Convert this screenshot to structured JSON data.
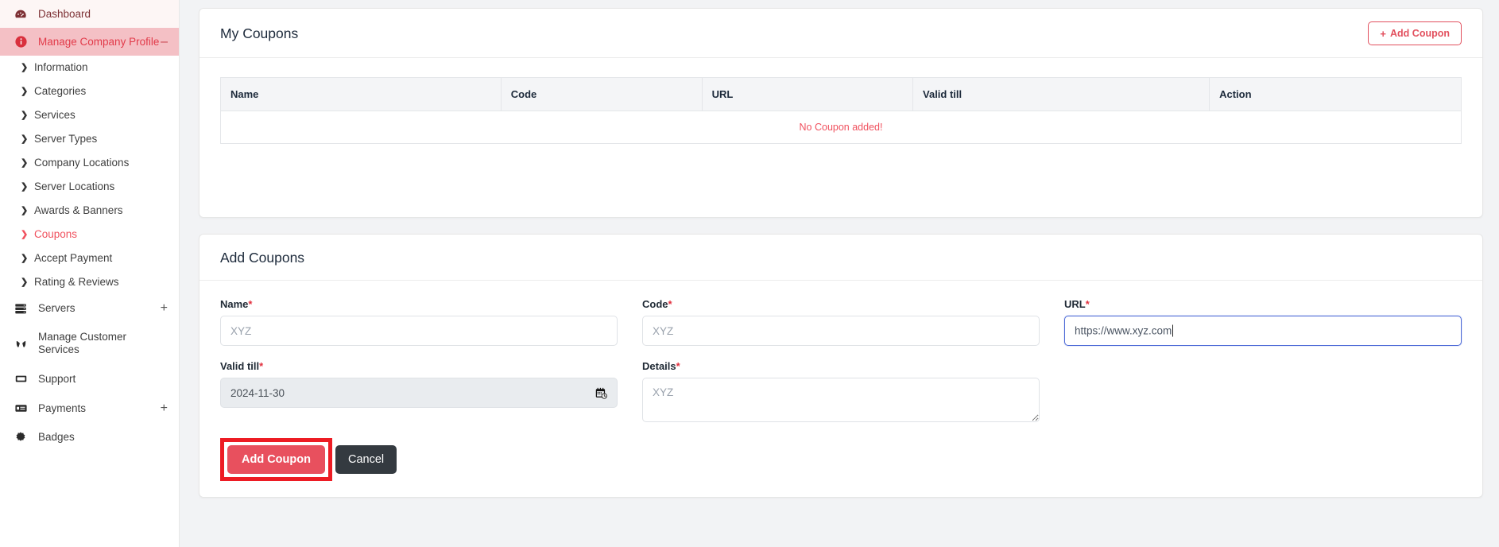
{
  "sidebar": {
    "top_items": [
      {
        "label": "Dashboard",
        "icon": "dashboard-gauge-icon",
        "toggle": "",
        "state": "top"
      },
      {
        "label": "Manage Company Profile",
        "icon": "info-circle-icon",
        "toggle": "–",
        "state": "active-parent"
      }
    ],
    "sub_items": [
      {
        "label": "Information",
        "active": false
      },
      {
        "label": "Categories",
        "active": false
      },
      {
        "label": "Services",
        "active": false
      },
      {
        "label": "Server Types",
        "active": false
      },
      {
        "label": "Company Locations",
        "active": false
      },
      {
        "label": "Server Locations",
        "active": false
      },
      {
        "label": "Awards & Banners",
        "active": false
      },
      {
        "label": "Coupons",
        "active": true
      },
      {
        "label": "Accept Payment",
        "active": false
      },
      {
        "label": "Rating & Reviews",
        "active": false
      }
    ],
    "bottom_items": [
      {
        "label": "Servers",
        "icon": "server-rack-icon",
        "toggle": "+"
      },
      {
        "label": "Manage Customer Services",
        "icon": "hands-icon",
        "toggle": ""
      },
      {
        "label": "Support",
        "icon": "ticket-icon",
        "toggle": ""
      },
      {
        "label": "Payments",
        "icon": "credit-card-icon",
        "toggle": "+"
      },
      {
        "label": "Badges",
        "icon": "badge-starburst-icon",
        "toggle": ""
      }
    ]
  },
  "coupons_card": {
    "title": "My Coupons",
    "add_button_label": "Add Coupon",
    "add_button_plus": "+",
    "table": {
      "headers": [
        "Name",
        "Code",
        "URL",
        "Valid till",
        "Action"
      ],
      "empty_message": "No Coupon added!"
    }
  },
  "form_card": {
    "title": "Add Coupons",
    "fields": {
      "name": {
        "label": "Name",
        "required": "*",
        "placeholder": "XYZ",
        "value": ""
      },
      "code": {
        "label": "Code",
        "required": "*",
        "placeholder": "XYZ",
        "value": ""
      },
      "url": {
        "label": "URL",
        "required": "*",
        "placeholder": "XYZ",
        "value": "https://www.xyz.com"
      },
      "valid_till": {
        "label": "Valid till",
        "required": "*",
        "value": "2024-11-30",
        "icon": "calendar-clock-icon"
      },
      "details": {
        "label": "Details",
        "required": "*",
        "placeholder": "XYZ",
        "value": ""
      }
    },
    "submit_label": "Add Coupon",
    "cancel_label": "Cancel"
  },
  "colors": {
    "accent_red": "#e8505e",
    "active_nav_bg": "#f4c0c5",
    "dark_button": "#343a40",
    "focus_blue": "#4a67d6",
    "highlight_annotation": "#ed1c24",
    "page_bg": "#f2f3f5"
  }
}
